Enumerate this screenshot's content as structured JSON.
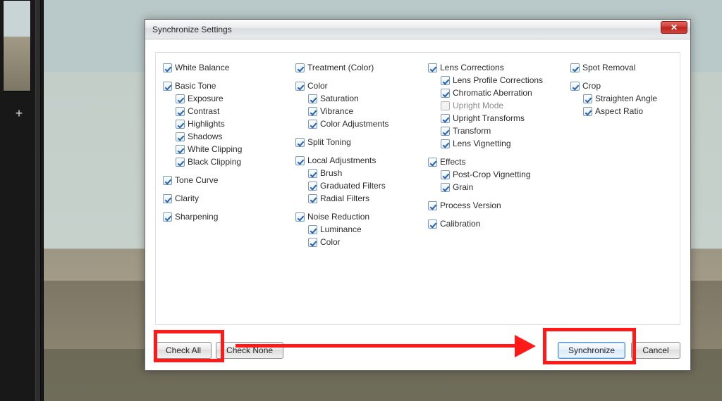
{
  "dialog": {
    "title": "Synchronize Settings",
    "buttons": {
      "check_all": "Check All",
      "check_none": "Check None",
      "synchronize": "Synchronize",
      "cancel": "Cancel"
    }
  },
  "cols": {
    "white_balance": "White Balance",
    "basic_tone": "Basic Tone",
    "basic_tone_children": {
      "exposure": "Exposure",
      "contrast": "Contrast",
      "highlights": "Highlights",
      "shadows": "Shadows",
      "white_clipping": "White Clipping",
      "black_clipping": "Black Clipping"
    },
    "tone_curve": "Tone Curve",
    "clarity": "Clarity",
    "sharpening": "Sharpening",
    "treatment": "Treatment (Color)",
    "color": "Color",
    "color_children": {
      "saturation": "Saturation",
      "vibrance": "Vibrance",
      "color_adjustments": "Color Adjustments"
    },
    "split_toning": "Split Toning",
    "local_adjustments": "Local Adjustments",
    "local_children": {
      "brush": "Brush",
      "graduated_filters": "Graduated Filters",
      "radial_filters": "Radial Filters"
    },
    "noise_reduction": "Noise Reduction",
    "noise_children": {
      "luminance": "Luminance",
      "color": "Color"
    },
    "lens_corrections": "Lens Corrections",
    "lens_children": {
      "lens_profile": "Lens Profile Corrections",
      "chromatic": "Chromatic Aberration",
      "upright_mode": "Upright Mode",
      "upright_transforms": "Upright Transforms",
      "transform": "Transform",
      "lens_vignetting": "Lens Vignetting"
    },
    "effects": "Effects",
    "effects_children": {
      "post_crop_vig": "Post-Crop Vignetting",
      "grain": "Grain"
    },
    "process_version": "Process Version",
    "calibration": "Calibration",
    "spot_removal": "Spot Removal",
    "crop": "Crop",
    "crop_children": {
      "straighten_angle": "Straighten Angle",
      "aspect_ratio": "Aspect Ratio"
    }
  }
}
